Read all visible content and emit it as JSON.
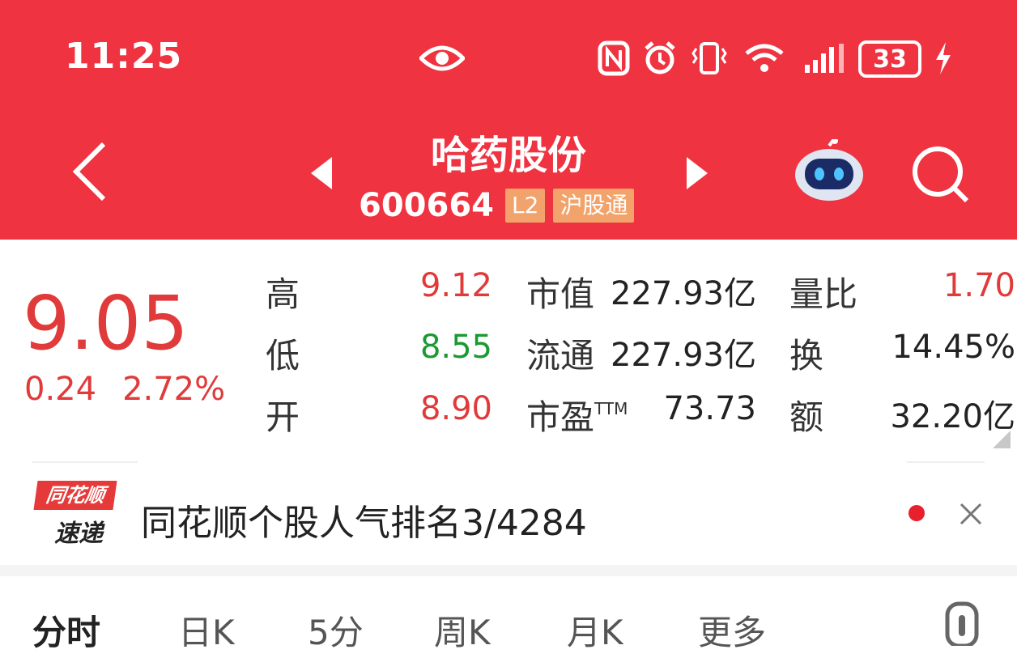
{
  "status_bar": {
    "time": "11:25",
    "battery": "33"
  },
  "header": {
    "stock_name": "哈药股份",
    "stock_code": "600664",
    "tag_level": "L2",
    "tag_connect": "沪股通"
  },
  "quote": {
    "price": "9.05",
    "change": "0.24",
    "change_pct": "2.72%",
    "rows": [
      {
        "l1": "高",
        "v1": "9.12",
        "l2": "市值",
        "v2": "227.93亿",
        "l3": "量比",
        "v3": "1.70"
      },
      {
        "l1": "低",
        "v1": "8.55",
        "l2": "流通",
        "v2": "227.93亿",
        "l3": "换",
        "v3": "14.45%"
      },
      {
        "l1": "开",
        "v1": "8.90",
        "l2": "市盈",
        "l2_sup": "TTM",
        "v2": "73.73",
        "l3": "额",
        "v3": "32.20亿"
      }
    ]
  },
  "news": {
    "logo_top": "同花顺",
    "logo_bottom": "速递",
    "text": "同花顺个股人气排名3/4284"
  },
  "tabs": [
    "分时",
    "日K",
    "5分",
    "周K",
    "月K",
    "更多"
  ],
  "colors": {
    "header_bg": "#ef3340",
    "up": "#e03a3a",
    "down": "#1a9a32"
  }
}
